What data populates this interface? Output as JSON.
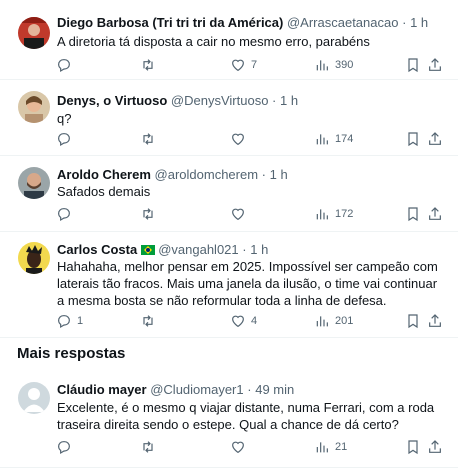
{
  "tweets": [
    {
      "name": "Diego Barbosa (Tri tri tri da América)",
      "handle": "@Arrascaetanacao",
      "dot": "·",
      "time": "1 h",
      "text": "A diretoria tá disposta a cair no mesmo erro, parabéns",
      "likes": "7",
      "views": "390",
      "replies": "",
      "retweets": ""
    },
    {
      "name": "Denys, o Virtuoso",
      "handle": "@DenysVirtuoso",
      "dot": "·",
      "time": "1 h",
      "text": "q?",
      "likes": "",
      "views": "174",
      "replies": "",
      "retweets": ""
    },
    {
      "name": "Aroldo Cherem",
      "handle": "@aroldomcherem",
      "dot": "·",
      "time": "1 h",
      "text": "Safados demais",
      "likes": "",
      "views": "172",
      "replies": "",
      "retweets": ""
    },
    {
      "name": "Carlos Costa",
      "handle": "@vangahl021",
      "dot": "·",
      "time": "1 h",
      "text": "Hahahaha, melhor pensar em 2025. Impossível ser campeão com laterais tão fracos. Mais uma janela da ilusão, o time vai continuar a mesma bosta se não reformular toda a linha de defesa.",
      "likes": "4",
      "views": "201",
      "replies": "1",
      "retweets": ""
    },
    {
      "name": "Cláudio mayer",
      "handle": "@Cludiomayer1",
      "dot": "·",
      "time": "49 min",
      "text": "Excelente, é o mesmo q viajar distante, numa Ferrari, com a roda traseira direita sendo o estepe. Qual a chance de dá certo?",
      "likes": "",
      "views": "21",
      "replies": "",
      "retweets": ""
    }
  ],
  "section_title": "Mais respostas",
  "icons": [
    "reply-icon",
    "retweet-icon",
    "like-icon",
    "views-icon",
    "bookmark-icon",
    "share-icon"
  ],
  "colors": {
    "text": "#0f1419",
    "secondary": "#536471",
    "divider": "#eff3f4"
  }
}
